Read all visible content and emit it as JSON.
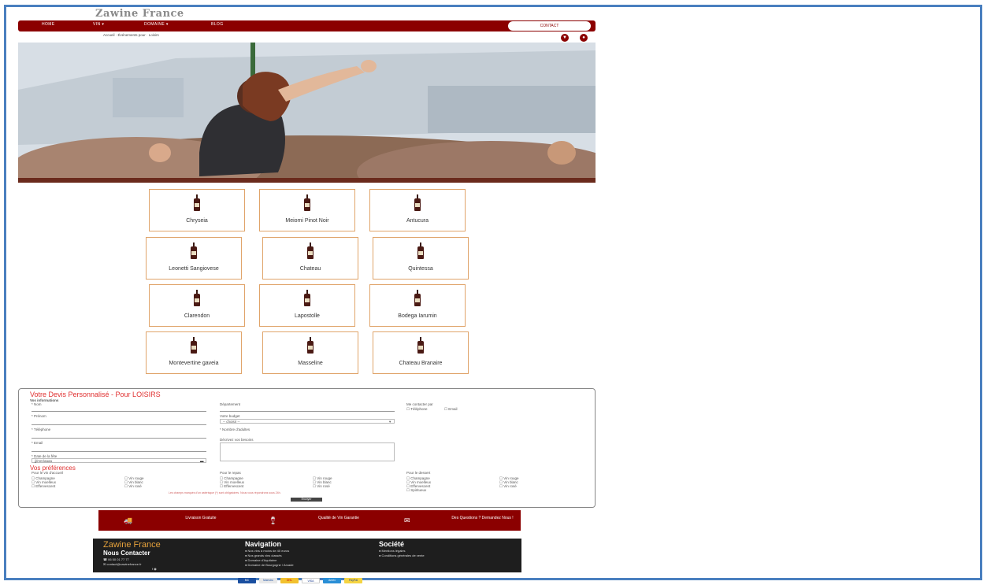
{
  "site": {
    "logo": "Zawine France",
    "nav": [
      "HOME",
      "VIN ▾",
      "DOMAINE ▾",
      "BLOG"
    ],
    "contact_label": "CONTACT",
    "breadcrumb": "Accueil · Événements pour · Loisirs"
  },
  "wines": [
    "Chryseia",
    "Meiomi Pinot Noir",
    "Antucura",
    "Leonetti Sangiovese",
    "Chateau",
    "Quintessa",
    "Clarendon",
    "Lapostolle",
    "Bodega Iarumin",
    "Montevertine gaveia",
    "Masseline",
    "Chateau Branaire"
  ],
  "devis": {
    "title": "Votre Devis Personnalisé - Pour LOISIRS",
    "info_heading": "Vos informations",
    "fields": [
      "* Nom",
      "* Prénom",
      "* Téléphone",
      "* Email",
      "* Date de la fête"
    ],
    "date_placeholder": "jj/mm/aaaa",
    "col2": [
      "Département",
      "Votre budget",
      "* Nombre d'adultes",
      "Décrivez vos besoins"
    ],
    "budget_placeholder": "-- choisir --",
    "contact_by": "Me contacter par",
    "contact_options": [
      "Téléphone",
      "Email"
    ],
    "prefs_title": "Vos préférences",
    "prefs_groups": [
      "Pour le vin d'accueil",
      "Pour le repas",
      "Pour le dessert"
    ],
    "prefs_left": [
      "Champagne",
      "Vin moelleux",
      "Effervescent"
    ],
    "prefs_right": [
      "Vin rouge",
      "Vin blanc",
      "Vin rosé"
    ],
    "prefs_extra": "Spiritueux",
    "notice": "Les champs marqués d'un astérisque (*) sont obligatoires. Nous vous répondrons sous 24h.",
    "submit": "Envoyer"
  },
  "features": [
    {
      "icon": "truck",
      "text": "Livraison Gratuite"
    },
    {
      "icon": "wine-glass",
      "text": "Qualité de Vin Garantie"
    },
    {
      "icon": "envelope",
      "text": "Des Questions ? Demandez Nous !"
    }
  ],
  "footer": {
    "brand": "Zawine France",
    "contact_heading": "Nous Contacter",
    "phone": "06 50 01 77 77",
    "email": "contact@zawinefrance.fr",
    "nav_heading": "Navigation",
    "nav_items": [
      "Nos vins à moins de 40 euros",
      "Nos grands vins classés",
      "Domaine d'Aquitaine",
      "Domaine de Bourgogne / Arcade"
    ],
    "societe_heading": "Société",
    "societe_items": [
      "Mentions légales",
      "Conditions générales de vente"
    ]
  },
  "payments": [
    "MC",
    "Maestro",
    "DHL",
    "VISA",
    "Amex",
    "PayPal"
  ],
  "colors": {
    "brand": "#8b0000",
    "accent": "#e6a23c",
    "frame": "#4a7fbf"
  }
}
